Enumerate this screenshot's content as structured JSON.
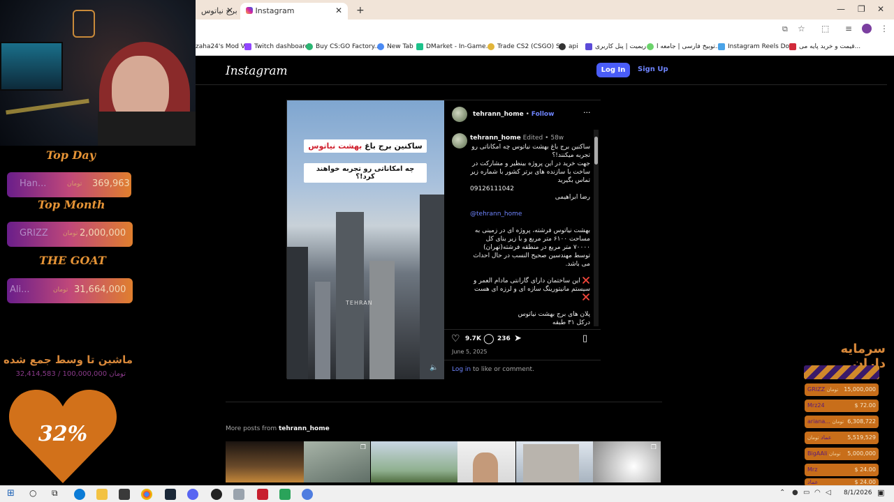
{
  "browser": {
    "tabs": [
      {
        "title": "برج نیاتوس"
      },
      {
        "title": "Instagram"
      }
    ],
    "new_tab": "+",
    "close": "✕",
    "bookmarks": [
      "zaha24's Mod V...",
      "Twitch dashboard",
      "Buy CS:GO Factory...",
      "New Tab",
      "DMarket - In-Game...",
      "Trade CS2 (CSGO) S...",
      "api",
      "ریمیت | پنل کاربری",
      "توبیخ فارسی | جامعه ا...",
      "Instagram Reels Do...",
      "قیمت و خرید پایه می..."
    ]
  },
  "instagram": {
    "logo": "Instagram",
    "login": "Log In",
    "signup": "Sign Up",
    "post": {
      "username": "tehrann_home",
      "follow": "Follow",
      "dot": "•",
      "more": "···",
      "edited": "Edited",
      "age": "58w",
      "overlay_line1_a": "ساکنین برج باغ",
      "overlay_line1_b": "بهشت نیاتوس",
      "overlay_line2": "چه امکاناتی رو تجربه خواهند کرد!؟",
      "watermark": "TEHRAN",
      "caption": [
        "ساکنین برج باغ بهشت نیاتوس چه امکاناتی رو تجربه میکنند!؟",
        "جهت خرید در این پروژه بینظیر و مشارکت در ساخت با سازنده های برتر کشور با شماره زیر تماس بگیرید",
        "09126111042",
        "رضا ابراهیمی",
        "@tehrann_home",
        "بهشت نیاتوس فرشته، پروژه ای در زمینی به مساحت ۶۱۰۰ متر مربع و با زیر بنای کل ۷۰۰۰۰ متر مربع در منطقه فرشته(تهران) توسط مهندسین صحیح النسب در حال احداث می باشد.",
        "❌ این ساختمان دارای گارانتی مادام العمر و سیستم مانیتورینگ سازه ای و لرزه ای هست ❌",
        "پلان های برج بهشت نیاتوس",
        "درکل ۳۱ طبقه"
      ],
      "likes": "9.7K",
      "comments": "236",
      "date": "June 5, 2025",
      "login_prompt_link": "Log in",
      "login_prompt_text": "to like or comment."
    },
    "more_posts_label": "More posts from",
    "more_posts_user": "tehrann_home"
  },
  "stream": {
    "top_day": "Top Day",
    "top_day_name": "Han...",
    "top_day_unit": "تومان",
    "top_day_amount": "369,963",
    "top_month": "Top Month",
    "top_month_name": "GRIZZ",
    "top_month_unit": "تومان",
    "top_month_amount": "2,000,000",
    "goat": "THE GOAT",
    "goat_name": "Ali...",
    "goat_unit": "تومان",
    "goat_amount": "31,664,000",
    "goal_title": "ماشین تا وسط جمع شده",
    "goal_amount": "32,414,583 / 100,000,000 تومان",
    "goal_percent": "32%",
    "investors_title": "سرمایه داران",
    "investors": [
      {
        "name": "GRIZZ",
        "unit": "تومان",
        "amount": "15,000,000"
      },
      {
        "name": "Mrz24",
        "unit": "",
        "amount": "$ 72.00"
      },
      {
        "name": "ariana...",
        "unit": "تومان",
        "amount": "6,308,722"
      },
      {
        "name": "عماد",
        "unit": "تومان",
        "amount": "5,519,529"
      },
      {
        "name": "BigAAli",
        "unit": "تومان",
        "amount": "5,000,000"
      },
      {
        "name": "Mrz",
        "unit": "",
        "amount": "$ 24.00"
      },
      {
        "name": "عماد",
        "unit": "",
        "amount": "$ 24.00"
      }
    ]
  },
  "taskbar": {
    "time": "",
    "date": "8/1/2026"
  },
  "colors": {
    "ig_blue": "#4a5df9",
    "overlay_orange": "#e69436"
  }
}
